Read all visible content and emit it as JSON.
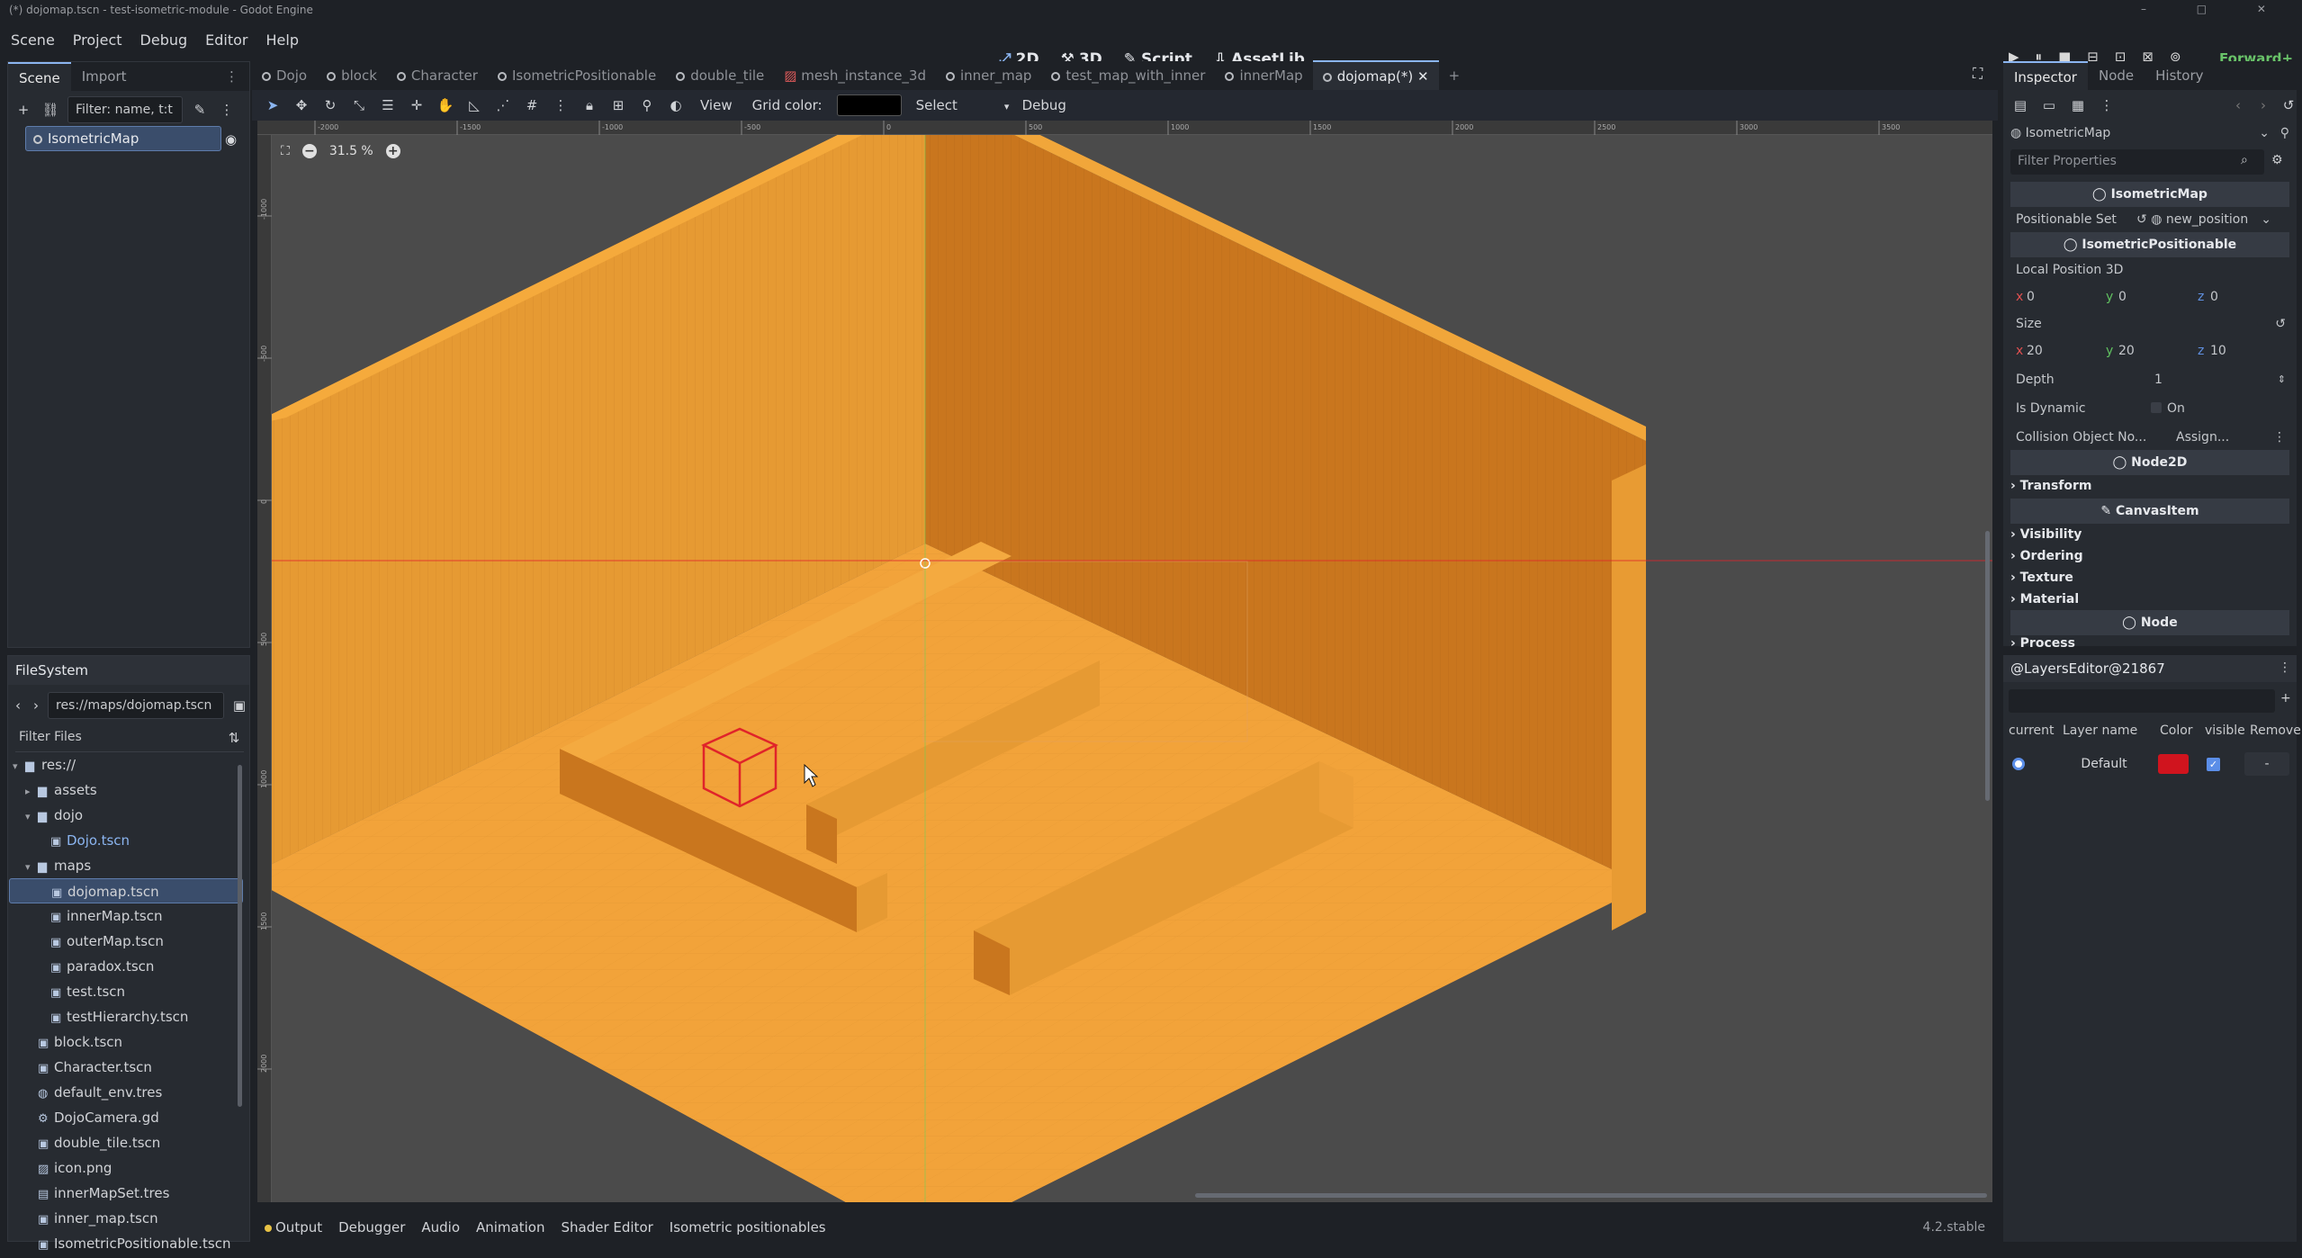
{
  "window": {
    "title": "(*) dojomap.tscn - test-isometric-module - Godot Engine",
    "controls": "– □ ✕"
  },
  "menu": [
    "Scene",
    "Project",
    "Debug",
    "Editor",
    "Help"
  ],
  "modes": [
    {
      "icon": "⤢",
      "label": "2D"
    },
    {
      "icon": "⚒",
      "label": "3D"
    },
    {
      "icon": "✎",
      "label": "Script"
    },
    {
      "icon": "⇩",
      "label": "AssetLib"
    }
  ],
  "run_buttons": [
    "▶",
    "⏸",
    "■",
    "⊟",
    "⊡",
    "⊠",
    "⊚"
  ],
  "renderer": "Forward+",
  "scene_dock": {
    "tabs": [
      "Scene",
      "Import"
    ],
    "filter_placeholder": "Filter: name, t:t",
    "root_node": "IsometricMap"
  },
  "filesystem": {
    "title": "FileSystem",
    "path": "res://maps/dojomap.tscn",
    "filter_placeholder": "Filter Files",
    "rows": [
      {
        "indent": 0,
        "arrow": "▾",
        "icon": "▆",
        "label": "res://"
      },
      {
        "indent": 1,
        "arrow": "▸",
        "icon": "▆",
        "label": "assets"
      },
      {
        "indent": 1,
        "arrow": "▾",
        "icon": "▆",
        "label": "dojo"
      },
      {
        "indent": 2,
        "arrow": "",
        "icon": "▣",
        "label": "Dojo.tscn",
        "open": true
      },
      {
        "indent": 1,
        "arrow": "▾",
        "icon": "▆",
        "label": "maps"
      },
      {
        "indent": 2,
        "arrow": "",
        "icon": "▣",
        "label": "dojomap.tscn",
        "selected": true
      },
      {
        "indent": 2,
        "arrow": "",
        "icon": "▣",
        "label": "innerMap.tscn"
      },
      {
        "indent": 2,
        "arrow": "",
        "icon": "▣",
        "label": "outerMap.tscn"
      },
      {
        "indent": 2,
        "arrow": "",
        "icon": "▣",
        "label": "paradox.tscn"
      },
      {
        "indent": 2,
        "arrow": "",
        "icon": "▣",
        "label": "test.tscn"
      },
      {
        "indent": 2,
        "arrow": "",
        "icon": "▣",
        "label": "testHierarchy.tscn"
      },
      {
        "indent": 1,
        "arrow": "",
        "icon": "▣",
        "label": "block.tscn"
      },
      {
        "indent": 1,
        "arrow": "",
        "icon": "▣",
        "label": "Character.tscn"
      },
      {
        "indent": 1,
        "arrow": "",
        "icon": "◍",
        "label": "default_env.tres"
      },
      {
        "indent": 1,
        "arrow": "",
        "icon": "⚙",
        "label": "DojoCamera.gd"
      },
      {
        "indent": 1,
        "arrow": "",
        "icon": "▣",
        "label": "double_tile.tscn"
      },
      {
        "indent": 1,
        "arrow": "",
        "icon": "▨",
        "label": "icon.png"
      },
      {
        "indent": 1,
        "arrow": "",
        "icon": "▤",
        "label": "innerMapSet.tres"
      },
      {
        "indent": 1,
        "arrow": "",
        "icon": "▣",
        "label": "inner_map.tscn"
      },
      {
        "indent": 1,
        "arrow": "",
        "icon": "▣",
        "label": "IsometricPositionable.tscn"
      }
    ]
  },
  "editor_tabs": [
    {
      "label": "Dojo"
    },
    {
      "label": "block"
    },
    {
      "label": "Character"
    },
    {
      "label": "IsometricPositionable"
    },
    {
      "label": "double_tile"
    },
    {
      "label": "mesh_instance_3d",
      "mesh": true
    },
    {
      "label": "inner_map"
    },
    {
      "label": "test_map_with_inner"
    },
    {
      "label": "innerMap"
    },
    {
      "label": "dojomap(*)",
      "active": true
    }
  ],
  "toolbar": {
    "view": "View",
    "grid_color_label": "Grid color:",
    "select": "Select",
    "debug": "Debug"
  },
  "viewport": {
    "zoom": "31.5 %",
    "ruler_ticks": [
      "-2000",
      "-1500",
      "-1000",
      "-500",
      "0",
      "500",
      "1000",
      "1500",
      "2000",
      "2500",
      "3000",
      "3500"
    ],
    "vruler_ticks": [
      "-1000",
      "-500",
      "0",
      "500",
      "1000",
      "1500",
      "2000"
    ]
  },
  "bottom_tabs": [
    "Output",
    "Debugger",
    "Audio",
    "Animation",
    "Shader Editor",
    "Isometric positionables"
  ],
  "version": "4.2.stable",
  "inspector": {
    "tabs": [
      "Inspector",
      "Node",
      "History"
    ],
    "node_name": "IsometricMap",
    "filter_placeholder": "Filter Properties",
    "sections": {
      "isometric_map": "IsometricMap",
      "isometric_positionable": "IsometricPositionable",
      "node2d": "Node2D",
      "canvas_item": "CanvasItem",
      "node": "Node"
    },
    "positionable_set_label": "Positionable Set",
    "positionable_set_value": "new_position",
    "local_position_label": "Local Position 3D",
    "local_position": {
      "x": "0",
      "y": "0",
      "z": "0"
    },
    "size_label": "Size",
    "size": {
      "x": "20",
      "y": "20",
      "z": "10"
    },
    "depth_label": "Depth",
    "depth": "1",
    "is_dynamic_label": "Is Dynamic",
    "is_dynamic_value": "On",
    "collision_label": "Collision Object No...",
    "collision_value": "Assign...",
    "groups": [
      "Transform",
      "Visibility",
      "Ordering",
      "Texture",
      "Material",
      "Process"
    ]
  },
  "layers_editor": {
    "title": "@LayersEditor@21867",
    "headers": [
      "current",
      "Layer name",
      "Color",
      "visible",
      "Remove"
    ],
    "rows": [
      {
        "name": "Default",
        "color": "#d0141e",
        "remove": "-"
      }
    ]
  },
  "colors": {
    "accent": "#8bb5f0",
    "floor": "#f2a33a",
    "wall_dark": "#c9761e",
    "wall_side": "#e5952e",
    "selection": "#e0242a"
  }
}
